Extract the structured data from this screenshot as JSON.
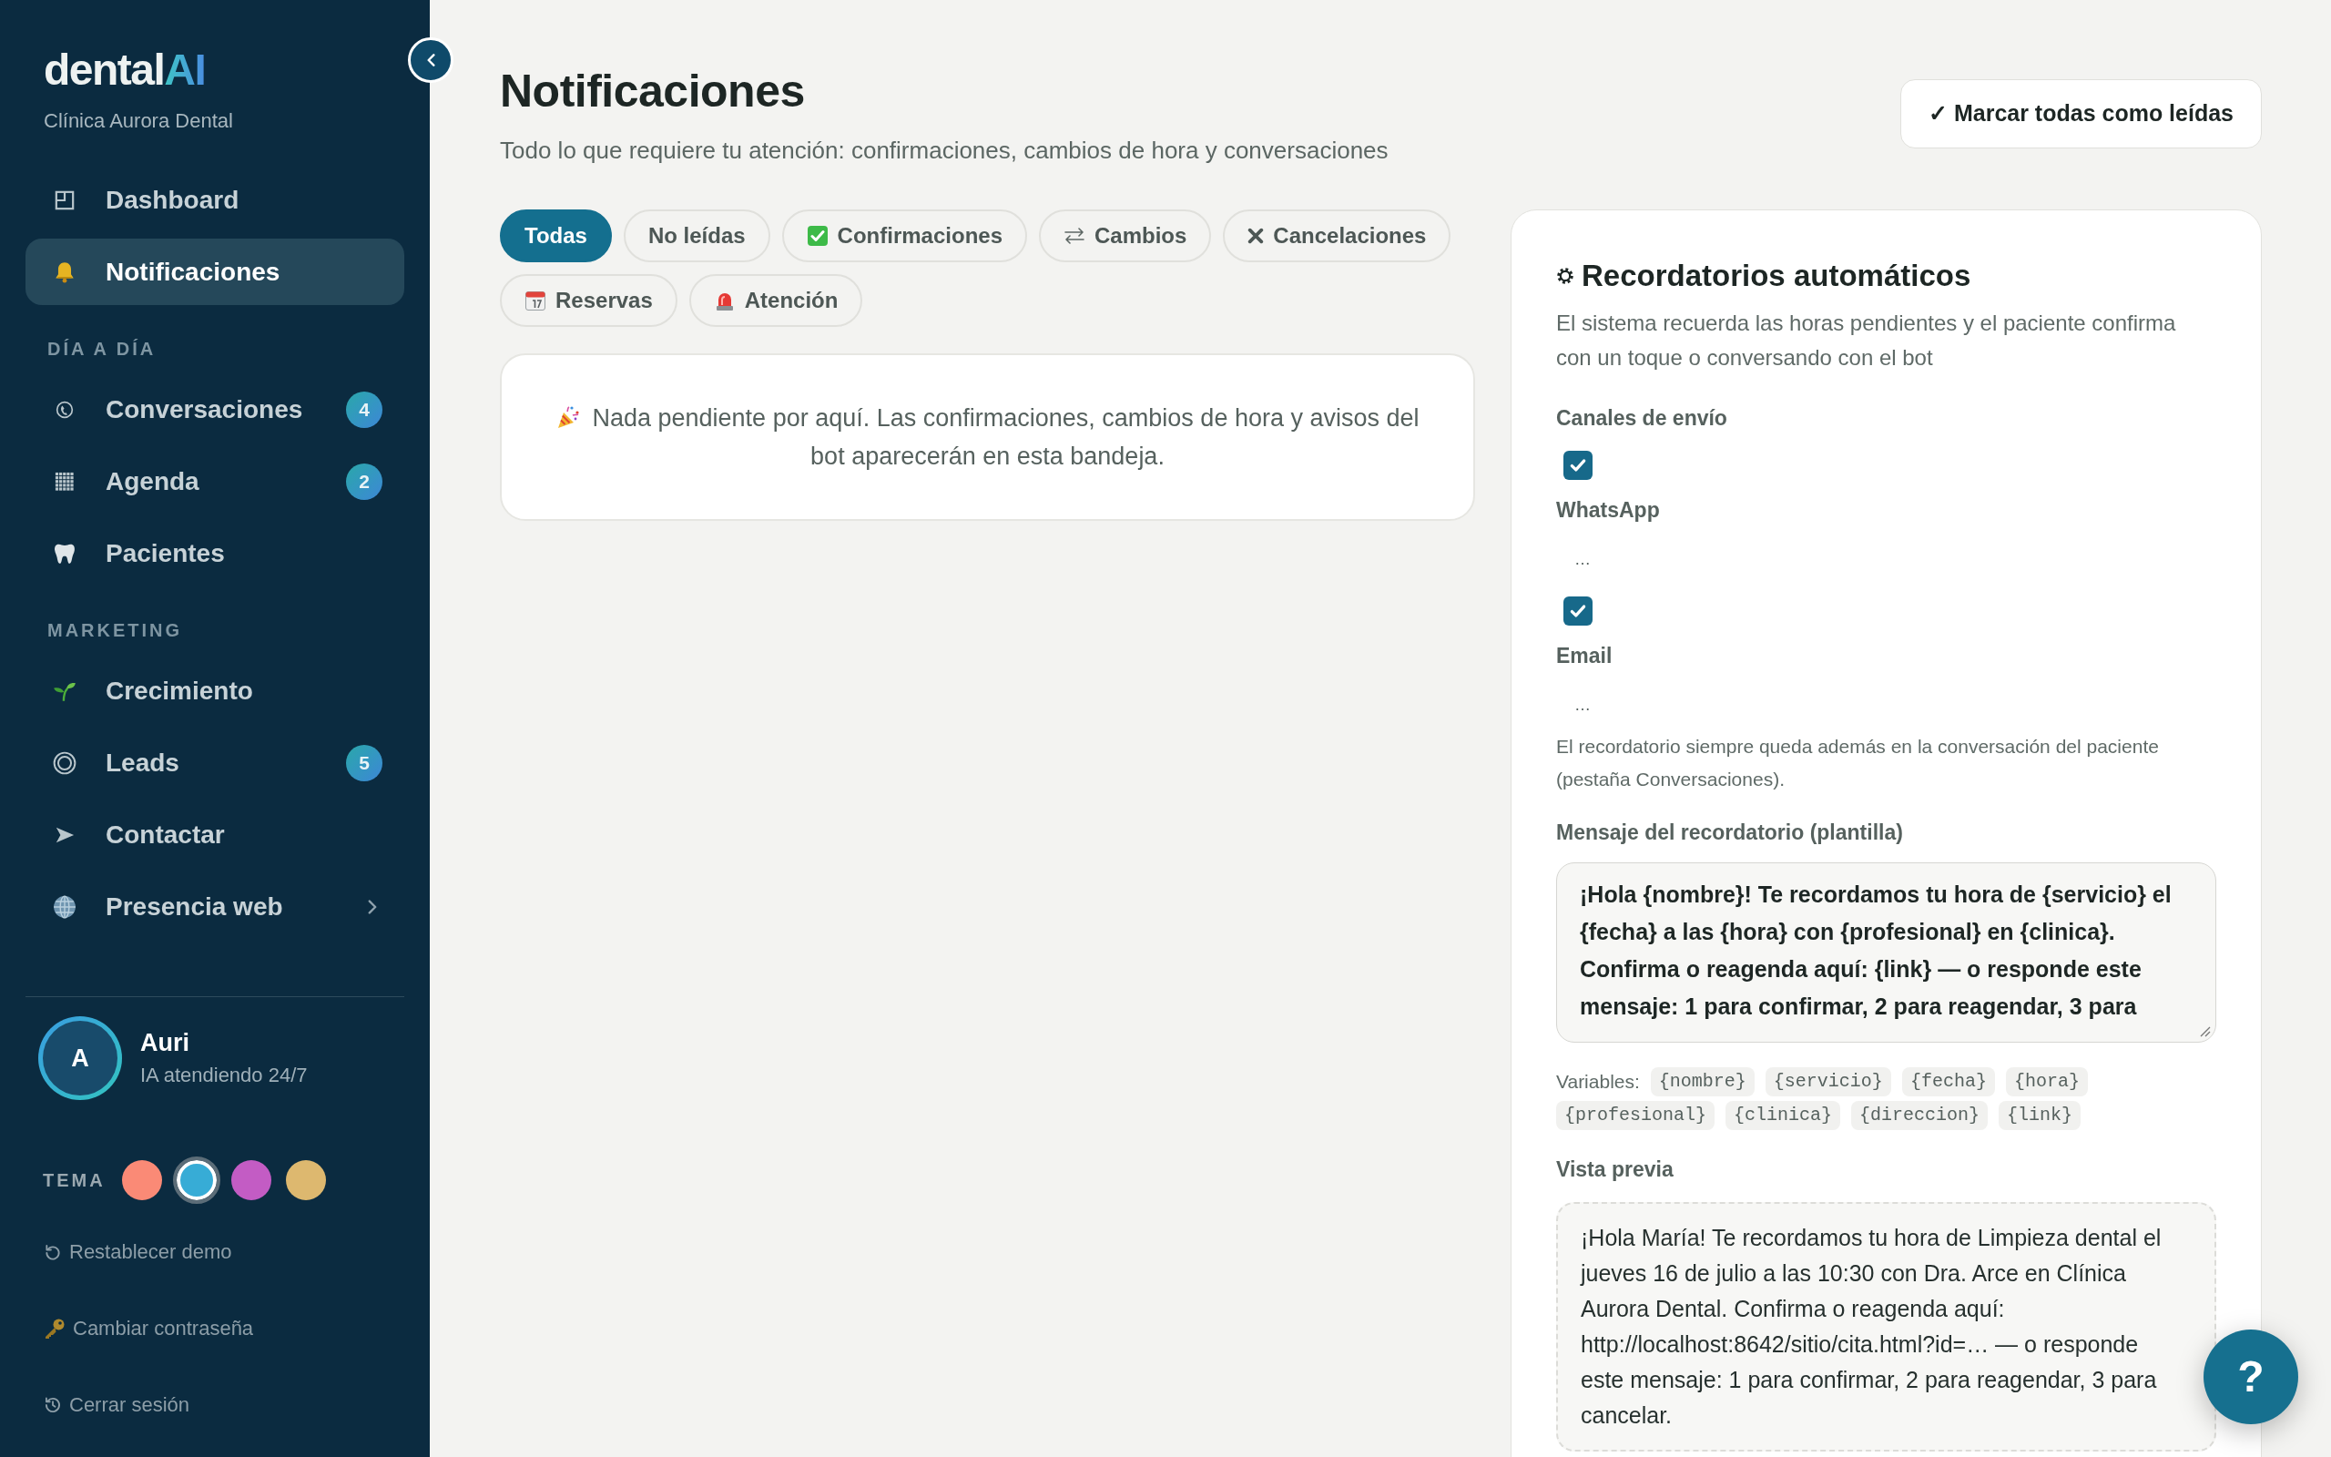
{
  "sidebar": {
    "logo": {
      "text": "dental",
      "accent": "AI"
    },
    "clinic": "Clínica Aurora Dental",
    "sections": [
      {
        "items": [
          {
            "label": "Dashboard",
            "selected": false,
            "kind": "link"
          },
          {
            "label": "Notificaciones",
            "selected": true,
            "kind": "link"
          }
        ]
      },
      {
        "title": "DÍA A DÍA",
        "items": [
          {
            "label": "Conversaciones",
            "selected": false,
            "kind": "link",
            "badge": "4"
          },
          {
            "label": "Agenda",
            "selected": false,
            "kind": "link",
            "badge": "2"
          },
          {
            "label": "Pacientes",
            "selected": false,
            "kind": "link"
          }
        ]
      },
      {
        "title": "MARKETING",
        "items": [
          {
            "label": "Crecimiento",
            "selected": false,
            "kind": "link"
          },
          {
            "label": "Leads",
            "selected": false,
            "kind": "link",
            "badge": "5"
          },
          {
            "label": "Contactar",
            "selected": false,
            "kind": "link"
          },
          {
            "label": "Presencia web",
            "selected": false,
            "kind": "group"
          }
        ]
      }
    ],
    "assistant": {
      "initial": "A",
      "name": "Auri",
      "status": "IA atendiendo 24/7"
    },
    "theme": {
      "label": "TEMA",
      "swatches": [
        {
          "color": "#fa8a76",
          "selected": false
        },
        {
          "color": "#37acd6",
          "selected": true
        },
        {
          "color": "#c35cc4",
          "selected": false
        },
        {
          "color": "#ddb86f",
          "selected": false
        }
      ]
    },
    "links": [
      "Restablecer demo",
      "Cambiar contraseña",
      "Cerrar sesión"
    ]
  },
  "header": {
    "title": "Notificaciones",
    "subtitle": "Todo lo que requiere tu atención: confirmaciones, cambios de hora y conversaciones",
    "action": "✓ Marcar todas como leídas"
  },
  "filters": [
    {
      "label": "Todas",
      "selected": true
    },
    {
      "label": "No leídas",
      "selected": false
    },
    {
      "label": "Confirmaciones",
      "selected": false
    },
    {
      "label": "Cambios",
      "selected": false
    },
    {
      "label": "Cancelaciones",
      "selected": false
    },
    {
      "label": "Reservas",
      "selected": false
    },
    {
      "label": "Atención",
      "selected": false
    }
  ],
  "empty_state": "Nada pendiente por aquí. Las confirmaciones, cambios de hora y avisos del bot aparecerán en esta bandeja.",
  "reminders": {
    "title": "Recordatorios automáticos",
    "description": "El sistema recuerda las horas pendientes y el paciente confirma con un toque o conversando con el bot",
    "channels_label": "Canales de envío",
    "channels": [
      {
        "label": "WhatsApp",
        "checked": true,
        "detail": "…"
      },
      {
        "label": "Email",
        "checked": true,
        "detail": "…"
      }
    ],
    "note": "El recordatorio siempre queda además en la conversación del paciente (pestaña Conversaciones).",
    "template_label": "Mensaje del recordatorio (plantilla)",
    "template": "¡Hola {nombre}! Te recordamos tu hora de {servicio} el {fecha} a las {hora} con {profesional} en {clinica}. Confirma o reagenda aquí: {link} — o responde este mensaje: 1 para confirmar, 2 para reagendar, 3 para",
    "variables_label": "Variables:",
    "variables": [
      "{nombre}",
      "{servicio}",
      "{fecha}",
      "{hora}",
      "{profesional}",
      "{clinica}",
      "{direccion}",
      "{link}"
    ],
    "preview_label": "Vista previa",
    "preview": "¡Hola María! Te recordamos tu hora de Limpieza dental el jueves 16 de julio a las 10:30 con Dra. Arce en Clínica Aurora Dental. Confirma o reagenda aquí: http://localhost:8642/sitio/cita.html?id=… — o responde este mensaje: 1 para confirmar, 2 para reagendar, 3 para cancelar."
  },
  "help_button": "?"
}
